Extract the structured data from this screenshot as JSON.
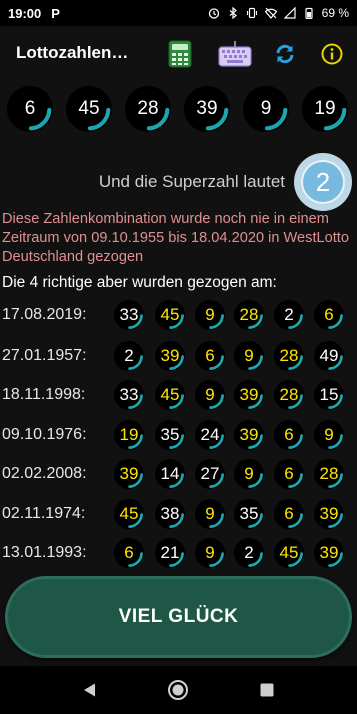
{
  "statusbar": {
    "time": "19:00",
    "app_letter": "P",
    "battery": "69 %"
  },
  "appbar": {
    "title": "Lottozahlen…"
  },
  "icons": {
    "calculator": "calculator-icon",
    "keyboard": "keyboard-icon",
    "refresh": "refresh-icon",
    "info": "info-icon"
  },
  "numbers": [
    "6",
    "45",
    "28",
    "39",
    "9",
    "19"
  ],
  "superzahl": {
    "label": "Und die Superzahl lautet",
    "value": "2"
  },
  "info_text": "Diese Zahlenkombination wurde noch nie in einem Zeitraum von 09.10.1955 bis 18.04.2020 in WestLotto Deutschland gezogen",
  "subheading": "Die 4 richtige aber wurden gezogen am:",
  "draws": [
    {
      "date": "17.08.2019:",
      "numbers": [
        "33",
        "45",
        "9",
        "28",
        "2",
        "6"
      ],
      "hits": [
        false,
        true,
        true,
        true,
        false,
        true
      ]
    },
    {
      "date": "27.01.1957:",
      "numbers": [
        "2",
        "39",
        "6",
        "9",
        "28",
        "49"
      ],
      "hits": [
        false,
        true,
        true,
        true,
        true,
        false
      ]
    },
    {
      "date": "18.11.1998:",
      "numbers": [
        "33",
        "45",
        "9",
        "39",
        "28",
        "15"
      ],
      "hits": [
        false,
        true,
        true,
        true,
        true,
        false
      ]
    },
    {
      "date": "09.10.1976:",
      "numbers": [
        "19",
        "35",
        "24",
        "39",
        "6",
        "9"
      ],
      "hits": [
        true,
        false,
        false,
        true,
        true,
        true
      ]
    },
    {
      "date": "02.02.2008:",
      "numbers": [
        "39",
        "14",
        "27",
        "9",
        "6",
        "28"
      ],
      "hits": [
        true,
        false,
        false,
        true,
        true,
        true
      ]
    },
    {
      "date": "02.11.1974:",
      "numbers": [
        "45",
        "38",
        "9",
        "35",
        "6",
        "39"
      ],
      "hits": [
        true,
        false,
        true,
        false,
        true,
        true
      ]
    },
    {
      "date": "13.01.1993:",
      "numbers": [
        "6",
        "21",
        "9",
        "2",
        "45",
        "39"
      ],
      "hits": [
        true,
        false,
        true,
        false,
        true,
        true
      ]
    }
  ],
  "cta_label": "VIEL GLÜCK",
  "colors": {
    "ring": "#1ba7ad",
    "hit": "#ffe600",
    "info_text": "#e09090",
    "button": "#1f5747"
  }
}
